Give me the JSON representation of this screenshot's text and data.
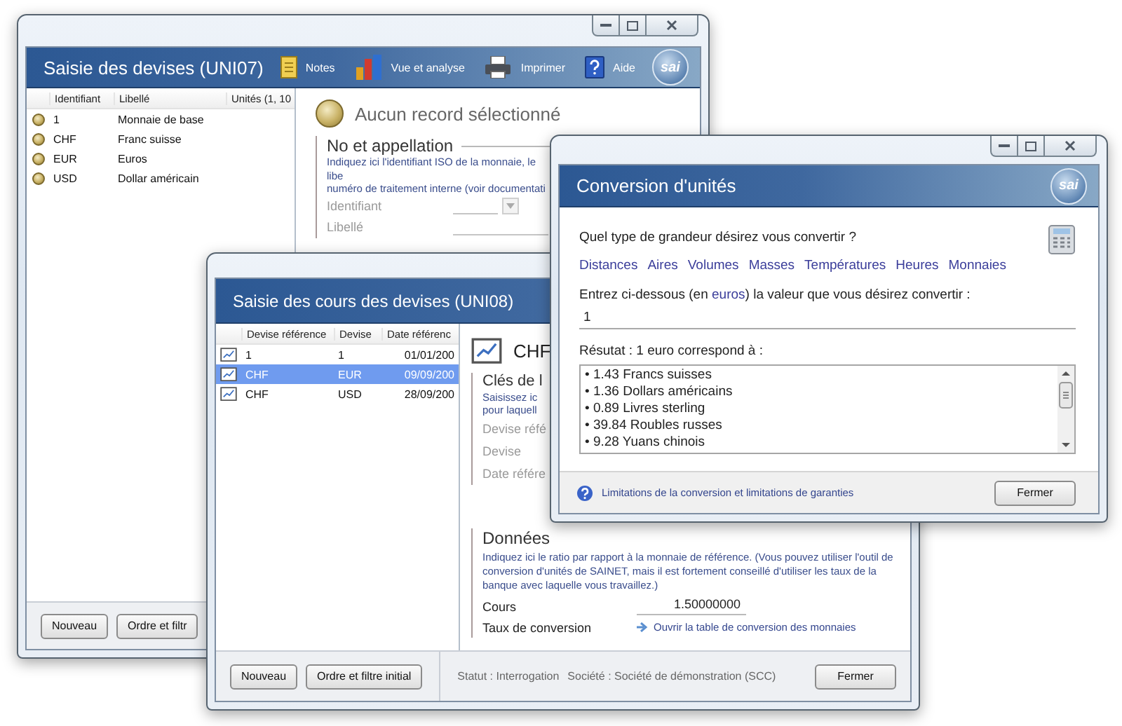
{
  "devises_window": {
    "title": "Saisie des devises (UNI07)",
    "toolbar": [
      {
        "kind": "notes",
        "label": "Notes"
      },
      {
        "kind": "analysis",
        "label": "Vue et analyse"
      },
      {
        "kind": "print",
        "label": "Imprimer"
      },
      {
        "kind": "help",
        "label": "Aide"
      }
    ],
    "logo": "sai",
    "list": {
      "columns": [
        "Identifiant",
        "Libellé",
        "Unités (1, 10"
      ],
      "rows": [
        {
          "cells": [
            "1",
            "Monnaie de base"
          ],
          "selected": false
        },
        {
          "cells": [
            "CHF",
            "Franc suisse"
          ],
          "selected": false
        },
        {
          "cells": [
            "EUR",
            "Euros"
          ],
          "selected": false
        },
        {
          "cells": [
            "USD",
            "Dollar américain"
          ],
          "selected": false
        }
      ]
    },
    "detail": {
      "heading": "Aucun record sélectionné",
      "section_title": "No et appellation",
      "section_lines": [
        "Indiquez ici l'identifiant ISO de la monnaie, le libe",
        "numéro de traitement interne (voir documentati"
      ],
      "fields": [
        {
          "kind": "dropdown",
          "label": "Identifiant"
        },
        {
          "kind": "text",
          "label": "Libellé"
        }
      ]
    },
    "buttons": [
      "Nouveau",
      "Ordre et filtr"
    ]
  },
  "cours_window": {
    "title": "Saisie des cours des devises (UNI08)",
    "list": {
      "columns": [
        "Devise référence",
        "Devise",
        "Date référenc"
      ],
      "rows": [
        {
          "cells": [
            "1",
            "1",
            "01/01/200"
          ],
          "selected": false
        },
        {
          "cells": [
            "CHF",
            "EUR",
            "09/09/200"
          ],
          "selected": true
        },
        {
          "cells": [
            "CHF",
            "USD",
            "28/09/200"
          ],
          "selected": false
        }
      ]
    },
    "record_title": "CHF",
    "keys_section": {
      "title": "Clés de l",
      "lines": [
        "Saisissez ic",
        "pour laquell"
      ],
      "fields": [
        "Devise réfé",
        "Devise",
        "Date référe"
      ]
    },
    "data_section": {
      "title": "Données",
      "text": "Indiquez ici le ratio par rapport à la monnaie de référence. (Vous pouvez utiliser l'outil de conversion d'unités de SAINET, mais il est fortement conseillé d'utiliser les taux de la banque avec laquelle vous travaillez.)",
      "rate_label": "Cours",
      "rate_value": "1.50000000",
      "conversion_label": "Taux de conversion",
      "conversion_link": "Ouvrir la table de conversion des monnaies"
    },
    "buttons": [
      "Nouveau",
      "Ordre et filtre initial"
    ],
    "status": "Statut : Interrogation",
    "company": "Société : Société de démonstration (SCC)",
    "close_button": "Fermer"
  },
  "conversion_window": {
    "title": "Conversion d'unités",
    "logo": "sai",
    "question": "Quel type de grandeur désirez vous convertir ?",
    "categories": [
      "Distances",
      "Aires",
      "Volumes",
      "Masses",
      "Températures",
      "Heures",
      "Monnaies"
    ],
    "prompt_before": "Entrez ci-dessous (en",
    "prompt_unit": "euros",
    "prompt_after": ") la valeur que vous désirez convertir :",
    "value": "1",
    "result_label": "Résutat : 1 euro correspond à :",
    "results": [
      "• 1.43 Francs suisses",
      "• 1.36 Dollars américains",
      "• 0.89 Livres sterling",
      "• 39.84 Roubles russes",
      "• 9.28 Yuans chinois"
    ],
    "help_link": "Limitations de la conversion et limitations de garanties",
    "close_button": "Fermer"
  }
}
